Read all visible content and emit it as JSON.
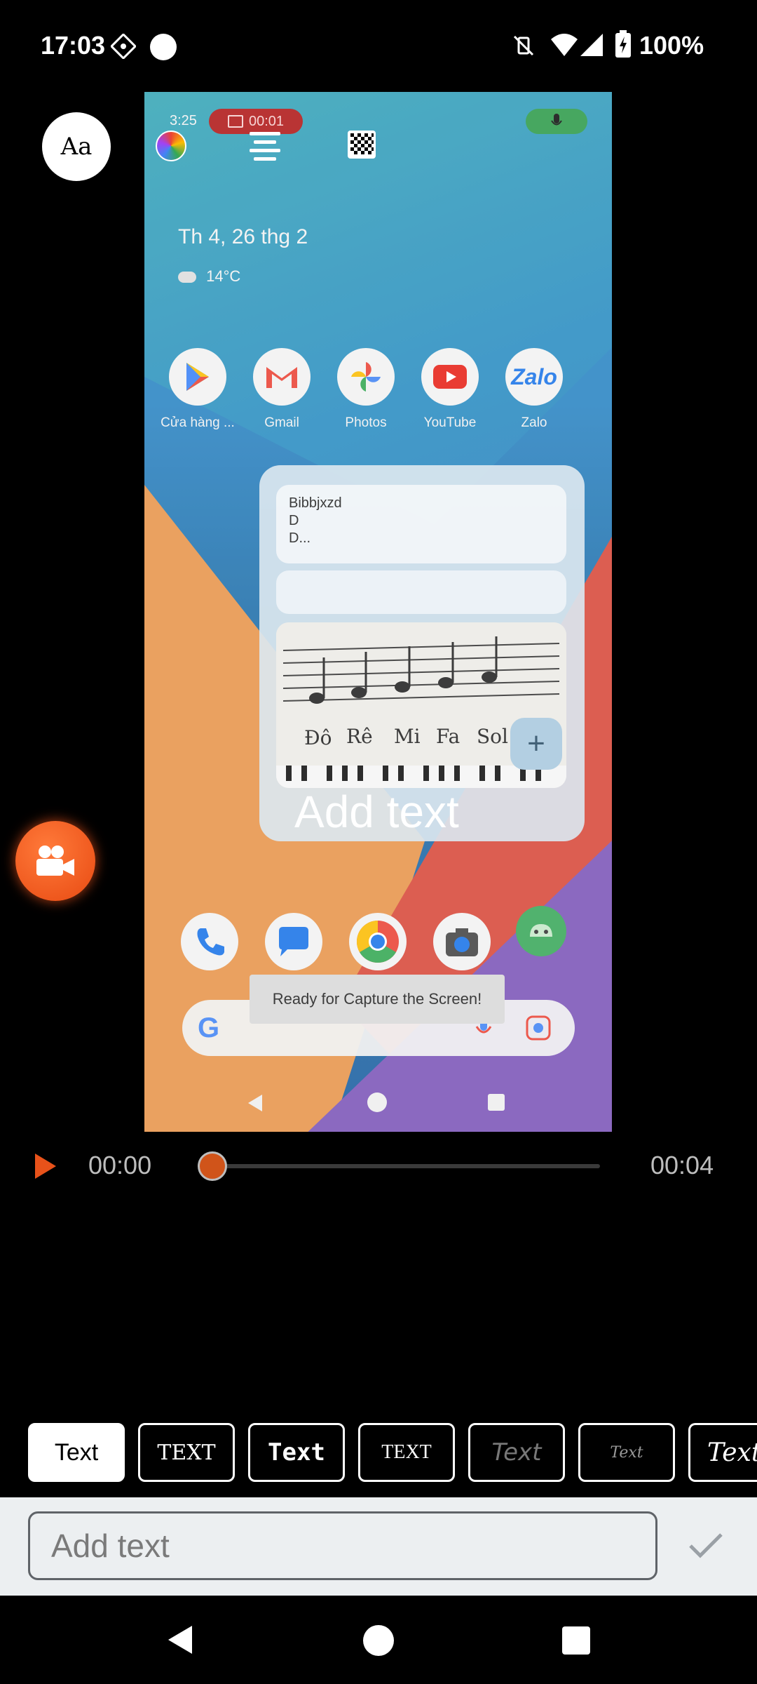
{
  "status_bar": {
    "time": "17:03",
    "battery": "100%"
  },
  "toolbar": {
    "font_label": "Aa"
  },
  "preview": {
    "time": "3:25",
    "rec_time": "00:01",
    "date": "Th 4, 26 thg 2",
    "weather": "14°C",
    "apps": [
      {
        "label": "Cửa hàng ...",
        "icon": "play-store-icon"
      },
      {
        "label": "Gmail",
        "icon": "gmail-icon"
      },
      {
        "label": "Photos",
        "icon": "photos-icon"
      },
      {
        "label": "YouTube",
        "icon": "youtube-icon"
      },
      {
        "label": "Zalo",
        "icon": "zalo-icon"
      }
    ],
    "note_lines": [
      "Bibbjxzd",
      "D",
      "D..."
    ],
    "photo_labels": [
      "Đô",
      "Rê",
      "Mi",
      "Fa",
      "Sol"
    ],
    "toast": "Ready for Capture the Screen!"
  },
  "overlay": {
    "text": "Add text"
  },
  "playback": {
    "start": "00:00",
    "end": "00:04",
    "progress": 0
  },
  "styles": [
    "Text",
    "TEXT",
    "Text",
    "TEXT",
    "Text",
    "Text",
    "Text"
  ],
  "input": {
    "placeholder": "Add text"
  },
  "colors": {
    "accent": "#e8521a",
    "input_bg": "#eceff1"
  }
}
